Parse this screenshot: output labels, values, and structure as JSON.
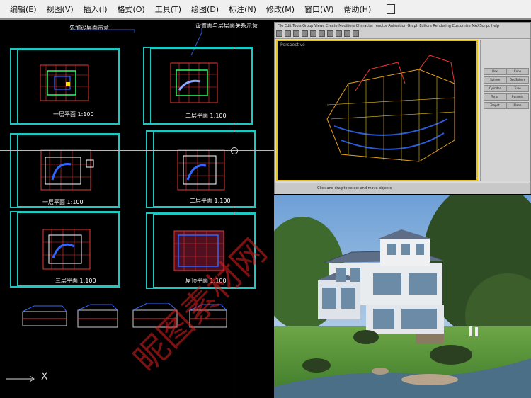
{
  "menubar": {
    "items": [
      {
        "id": "edit",
        "label": "编辑(E)"
      },
      {
        "id": "view",
        "label": "视图(V)"
      },
      {
        "id": "insert",
        "label": "插入(I)"
      },
      {
        "id": "format",
        "label": "格式(O)"
      },
      {
        "id": "tools",
        "label": "工具(T)"
      },
      {
        "id": "draw",
        "label": "绘图(D)"
      },
      {
        "id": "dimension",
        "label": "标注(N)"
      },
      {
        "id": "modify",
        "label": "修改(M)"
      },
      {
        "id": "window",
        "label": "窗口(W)"
      },
      {
        "id": "help",
        "label": "帮助(H)"
      }
    ]
  },
  "drawing": {
    "caption_left": "先加设层面示意",
    "caption_right": "设置面与层层面关系示意",
    "ucs_label": "X",
    "sheet_titles": [
      "一层平面 1:100",
      "二层平面 1:100",
      "一层平面 1:100",
      "二层平面 1:100",
      "三层平面 1:100",
      "屋顶平面 1:100"
    ]
  },
  "max_window": {
    "menu_text": "File  Edit  Tools  Group  Views  Create  Modifiers  Character  reactor  Animation  Graph Editors  Rendering  Customize  MAXScript  Help",
    "viewport_label": "Perspective",
    "command_buttons": [
      "Box",
      "Cone",
      "Sphere",
      "GeoSphere",
      "Cylinder",
      "Tube",
      "Torus",
      "Pyramid",
      "Teapot",
      "Plane"
    ],
    "status_text": "Click and drag to select and move objects"
  },
  "watermark": {
    "text": "昵图素材网"
  },
  "colors": {
    "sheet_border": "#1ec7c0",
    "viewport_border": "#e7c21a",
    "watermark": "#e02020"
  }
}
